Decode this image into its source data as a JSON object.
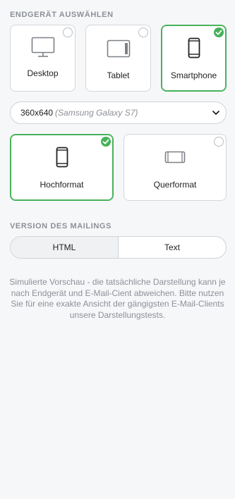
{
  "device_section": {
    "title": "ENDGERÄT AUSWÄHLEN",
    "devices": [
      {
        "label": "Desktop",
        "icon": "desktop-icon",
        "selected": false
      },
      {
        "label": "Tablet",
        "icon": "tablet-icon",
        "selected": false
      },
      {
        "label": "Smartphone",
        "icon": "smartphone-icon",
        "selected": true
      }
    ]
  },
  "resolution_select": {
    "value": "360x640",
    "hint": "(Samsung Galaxy S7)"
  },
  "orientation": {
    "options": [
      {
        "label": "Hochformat",
        "icon": "portrait-icon",
        "selected": true
      },
      {
        "label": "Querformat",
        "icon": "landscape-icon",
        "selected": false
      }
    ]
  },
  "version_section": {
    "title": "VERSION DES MAILINGS",
    "options": [
      "HTML",
      "Text"
    ],
    "active": "HTML"
  },
  "note": "Simulierte Vorschau - die tatsächliche Darstellung kann je nach Endgerät und E-Mail-Cient abweichen. Bitte nutzen Sie für eine exakte Ansicht der gängigsten E-Mail-Clients unsere Darstellungstests.",
  "colors": {
    "accent_green": "#46b25a",
    "background": "#f6f7f9",
    "muted_text": "#8c9097"
  }
}
